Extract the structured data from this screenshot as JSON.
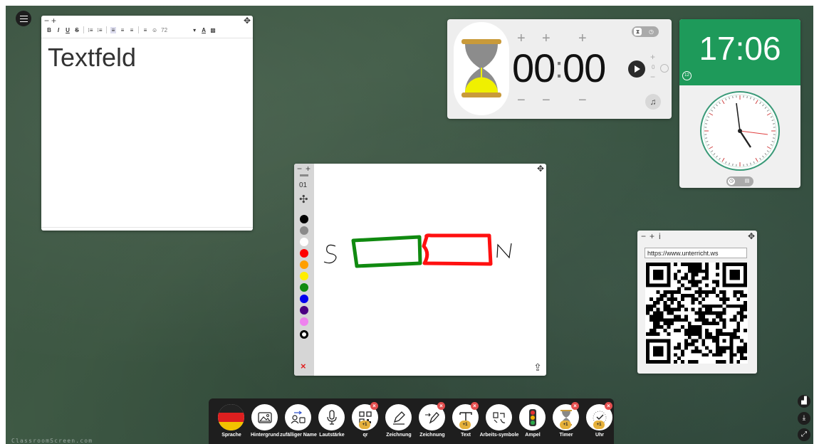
{
  "menu": {
    "icon": "hamburger-icon"
  },
  "text_widget": {
    "zoom_minus": "−",
    "zoom_plus": "+",
    "toolbar": {
      "bold": "B",
      "italic": "I",
      "underline": "U",
      "strike": "S",
      "font_size": "72",
      "text_color": "A"
    },
    "content": "Textfeld"
  },
  "timer_widget": {
    "minutes": "00",
    "colon": ":",
    "seconds": "00",
    "repeat_count": "0",
    "plus": "+",
    "minus": "−",
    "accent": "#f0f000"
  },
  "clock_widget": {
    "time": "17:06",
    "badge": "12",
    "accent": "#1e9a5a"
  },
  "drawing_widget": {
    "zoom_minus": "−",
    "zoom_plus": "+",
    "line_width": "01",
    "colors": [
      "#000000",
      "#8a8a8a",
      "#ffffff",
      "#ff0000",
      "#ff9f00",
      "#ffee00",
      "#108a10",
      "#0000ee",
      "#4b0082",
      "#ee82ee"
    ],
    "clear": "×",
    "labels": {
      "south": "S",
      "north": "N"
    }
  },
  "qr_widget": {
    "zoom_minus": "−",
    "zoom_plus": "+",
    "info": "i",
    "url": "https://www.unterricht.ws"
  },
  "dock": {
    "items": [
      {
        "label": "Sprache",
        "icon": "german-flag-icon"
      },
      {
        "label": "Hintergrund",
        "icon": "image-icon"
      },
      {
        "label": "zufälliger Name",
        "icon": "random-name-icon"
      },
      {
        "label": "Lautstärke",
        "icon": "microphone-icon"
      },
      {
        "label": "qr",
        "icon": "qr-code-icon"
      },
      {
        "label": "Zeichnung",
        "icon": "pencil-icon"
      },
      {
        "label": "Zeichnung",
        "icon": "pencil-arrow-icon"
      },
      {
        "label": "Text",
        "icon": "text-icon"
      },
      {
        "label": "Arbeits-symbole",
        "icon": "work-symbols-icon"
      },
      {
        "label": "Ampel",
        "icon": "traffic-light-icon"
      },
      {
        "label": "Timer",
        "icon": "hourglass-icon"
      },
      {
        "label": "Uhr",
        "icon": "clock-icon"
      }
    ],
    "plus_one": "+1"
  },
  "watermark": "ClassroomScreen.com"
}
